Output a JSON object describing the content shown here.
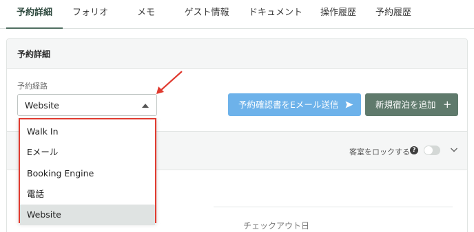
{
  "tabs": [
    {
      "label": "予約詳細",
      "active": true
    },
    {
      "label": "フォリオ"
    },
    {
      "label": "メモ"
    },
    {
      "label": "ゲスト情報"
    },
    {
      "label": "ドキュメント"
    },
    {
      "label": "操作履歴"
    },
    {
      "label": "予約履歴"
    }
  ],
  "card": {
    "title": "予約詳細",
    "route_label": "予約経路",
    "route_value": "Website",
    "send_button": "予約確認書をEメール送信",
    "add_button": "新規宿泊を追加"
  },
  "room": {
    "lock_label": "客室をロックする",
    "help_glyph": "?",
    "lock_enabled": false
  },
  "dates": {
    "checkout_label": "チェックアウト日"
  },
  "dropdown": {
    "options": [
      "Walk In",
      "Eメール",
      "Booking Engine",
      "電話",
      "Website"
    ],
    "selected": "Website"
  },
  "colors": {
    "accent": "#5f7a6c",
    "send_button": "#6db2ea",
    "highlight": "#e03a2f"
  },
  "icons": {
    "caret": "caret-up-icon",
    "send": "send-icon",
    "plus": "plus-icon",
    "help": "help-icon",
    "chevron": "chevron-down-icon"
  }
}
